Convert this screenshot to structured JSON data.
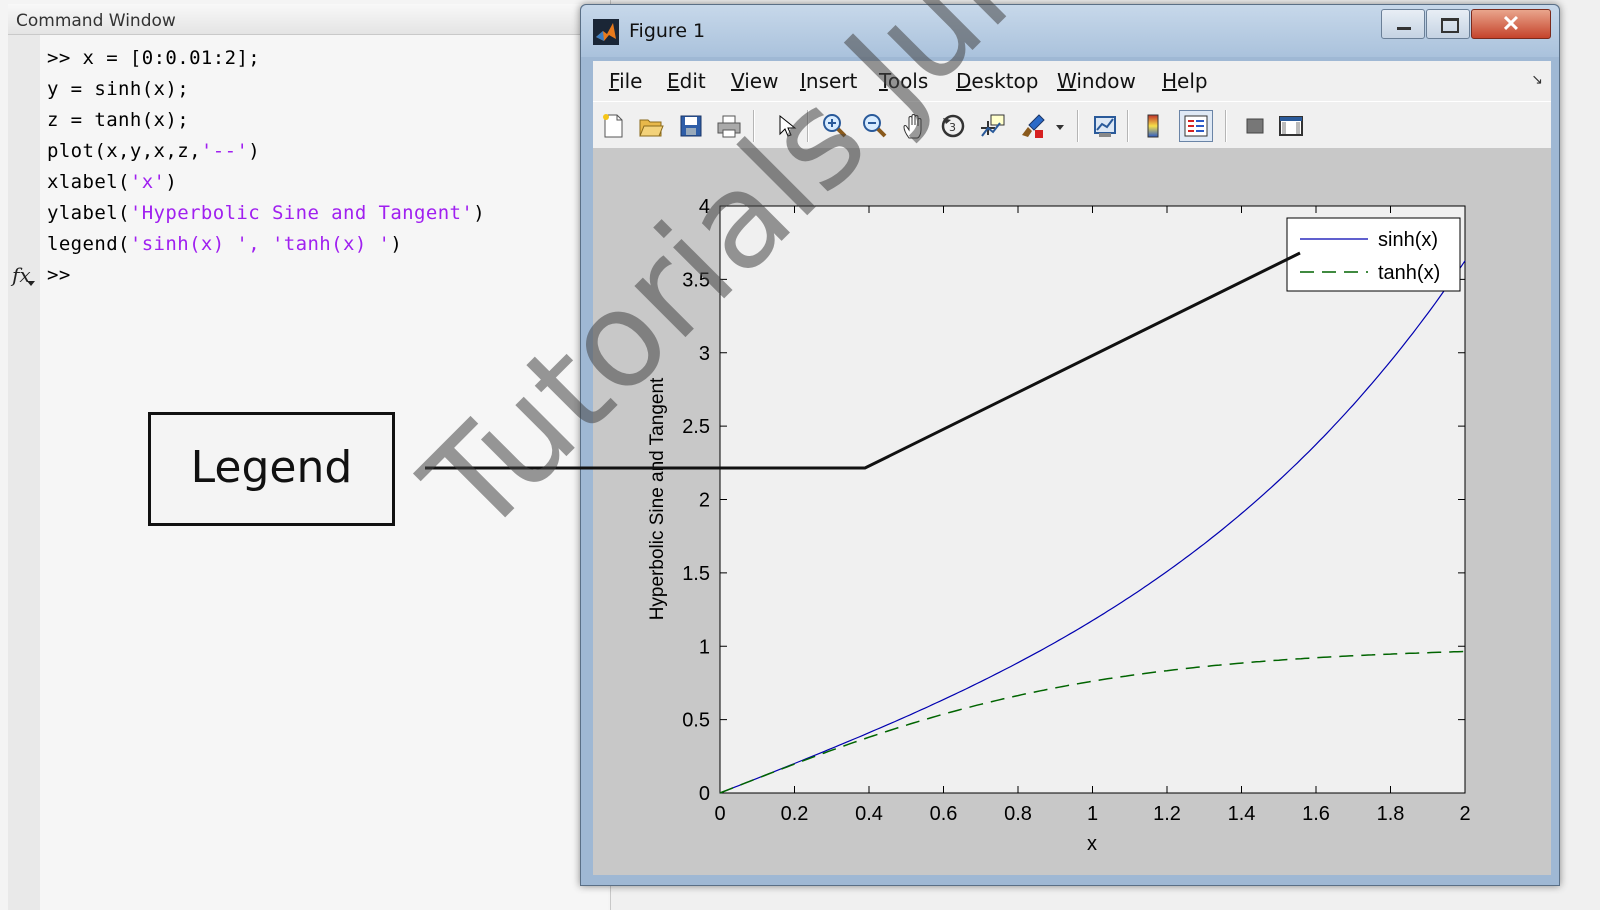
{
  "command_window": {
    "title": "Command Window",
    "lines": [
      {
        "prefix": ">> ",
        "code": "x = [0:0.01:2];",
        "string": "",
        "suffix": ""
      },
      {
        "prefix": "",
        "code": "y = sinh(x);",
        "string": "",
        "suffix": ""
      },
      {
        "prefix": "",
        "code": "z = tanh(x);",
        "string": "",
        "suffix": ""
      },
      {
        "prefix": "",
        "code": "plot(x,y,x,z,",
        "string": "'--'",
        "suffix": ")"
      },
      {
        "prefix": "",
        "code": "xlabel(",
        "string": "'x'",
        "suffix": ")"
      },
      {
        "prefix": "",
        "code": "ylabel(",
        "string": "'Hyperbolic Sine and Tangent'",
        "suffix": ")"
      },
      {
        "prefix": "",
        "code": "legend(",
        "string": "'sinh(x) ', 'tanh(x) '",
        "suffix": ")"
      },
      {
        "prefix": ">>",
        "code": "",
        "string": "",
        "suffix": ""
      }
    ],
    "fx_label": "fx"
  },
  "callout": {
    "label": "Legend"
  },
  "watermark": "Tutorials Junk",
  "figure_window": {
    "title": "Figure 1",
    "menu": [
      {
        "u": "F",
        "rest": "ile"
      },
      {
        "u": "E",
        "rest": "dit"
      },
      {
        "u": "V",
        "rest": "iew"
      },
      {
        "u": "I",
        "rest": "nsert"
      },
      {
        "u": "T",
        "rest": "ools"
      },
      {
        "u": "D",
        "rest": "esktop"
      },
      {
        "u": "W",
        "rest": "indow"
      },
      {
        "u": "H",
        "rest": "elp"
      }
    ],
    "toolbar_icons": [
      "new-figure-icon",
      "open-file-icon",
      "save-icon",
      "print-icon",
      "select-arrow-icon",
      "zoom-in-icon",
      "zoom-out-icon",
      "pan-hand-icon",
      "rotate-3d-icon",
      "data-cursor-icon",
      "brush-icon",
      "brush-dropdown-icon",
      "link-plot-icon",
      "insert-colorbar-icon",
      "insert-legend-icon",
      "hide-plot-tools-icon",
      "show-plot-tools-icon"
    ],
    "colors": {
      "sinh": "#0000b0",
      "tanh": "#006400"
    }
  },
  "chart_data": {
    "type": "line",
    "xlabel": "x",
    "ylabel": "Hyperbolic Sine and Tangent",
    "xlim": [
      0,
      2
    ],
    "ylim": [
      0,
      4
    ],
    "xticks": [
      "0",
      "0.2",
      "0.4",
      "0.6",
      "0.8",
      "1",
      "1.2",
      "1.4",
      "1.6",
      "1.8",
      "2"
    ],
    "yticks": [
      "0",
      "0.5",
      "1",
      "1.5",
      "2",
      "2.5",
      "3",
      "3.5",
      "4"
    ],
    "legend_position": "top-right",
    "series": [
      {
        "name": "sinh(x)",
        "style": "solid",
        "x": [
          0,
          0.2,
          0.4,
          0.6,
          0.8,
          1,
          1.2,
          1.4,
          1.6,
          1.8,
          2
        ],
        "y": [
          0,
          0.201,
          0.411,
          0.637,
          0.888,
          1.175,
          1.509,
          1.904,
          2.376,
          2.942,
          3.627
        ]
      },
      {
        "name": "tanh(x)",
        "style": "dashed",
        "x": [
          0,
          0.2,
          0.4,
          0.6,
          0.8,
          1,
          1.2,
          1.4,
          1.6,
          1.8,
          2
        ],
        "y": [
          0,
          0.197,
          0.38,
          0.537,
          0.664,
          0.762,
          0.834,
          0.885,
          0.922,
          0.947,
          0.964
        ]
      }
    ]
  }
}
